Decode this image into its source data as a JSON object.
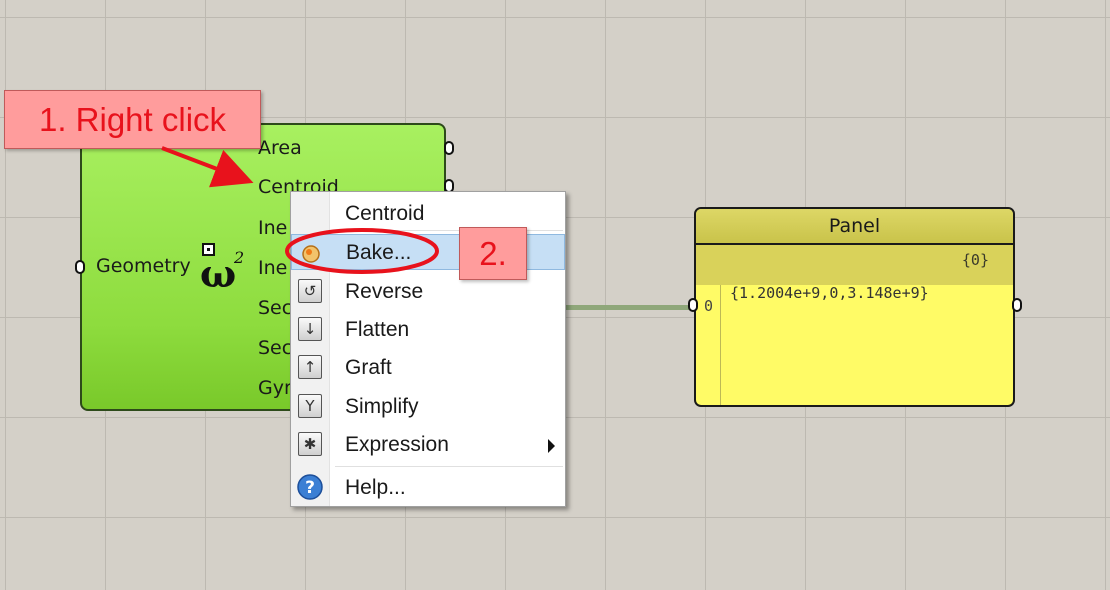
{
  "component": {
    "input_label": "Geometry",
    "icon": "omega-squared-icon",
    "outputs": [
      "Area",
      "Centroid",
      "Ine",
      "Ine",
      "Sec",
      "Sec",
      "Gyr"
    ]
  },
  "context_menu": {
    "title": "Centroid",
    "items": [
      {
        "label": "Bake...",
        "icon": "bake-icon",
        "highlighted": true
      },
      {
        "label": "Reverse",
        "icon": "reverse-icon"
      },
      {
        "label": "Flatten",
        "icon": "flatten-icon"
      },
      {
        "label": "Graft",
        "icon": "graft-icon"
      },
      {
        "label": "Simplify",
        "icon": "simplify-icon"
      },
      {
        "label": "Expression",
        "icon": "expression-icon",
        "submenu": true
      },
      {
        "label": "Help...",
        "icon": "help-icon"
      }
    ]
  },
  "panel": {
    "title": "Panel",
    "branch": "{0}",
    "index": "0",
    "value": "{1.2004e+9,0,3.148e+9}"
  },
  "annotations": {
    "step1": "1. Right click",
    "step2": "2."
  },
  "colors": {
    "canvas": "#d4d0c8",
    "component": "#8edc3e",
    "panel": "#fffb66",
    "highlight": "#c6dff5",
    "annotation": "#e8121c"
  }
}
